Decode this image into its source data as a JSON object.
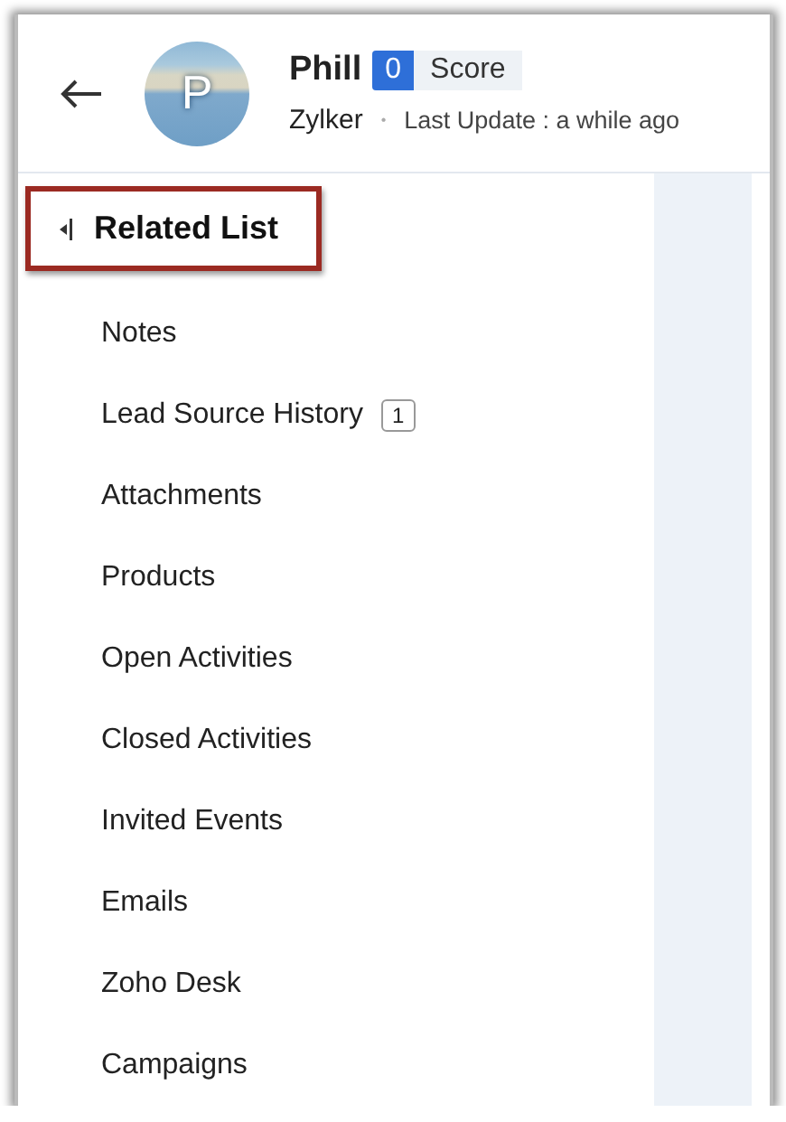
{
  "header": {
    "avatar_initial": "P",
    "name": "Phill",
    "score": {
      "value": "0",
      "label": "Score"
    },
    "company": "Zylker",
    "separator": "•",
    "last_update": "Last Update : a while ago"
  },
  "related_list": {
    "title": "Related List",
    "highlighted": true,
    "items": [
      {
        "label": "Notes"
      },
      {
        "label": "Lead Source History",
        "count": "1"
      },
      {
        "label": "Attachments"
      },
      {
        "label": "Products"
      },
      {
        "label": "Open Activities"
      },
      {
        "label": "Closed Activities"
      },
      {
        "label": "Invited Events"
      },
      {
        "label": "Emails"
      },
      {
        "label": "Zoho Desk"
      },
      {
        "label": "Campaigns"
      }
    ]
  }
}
